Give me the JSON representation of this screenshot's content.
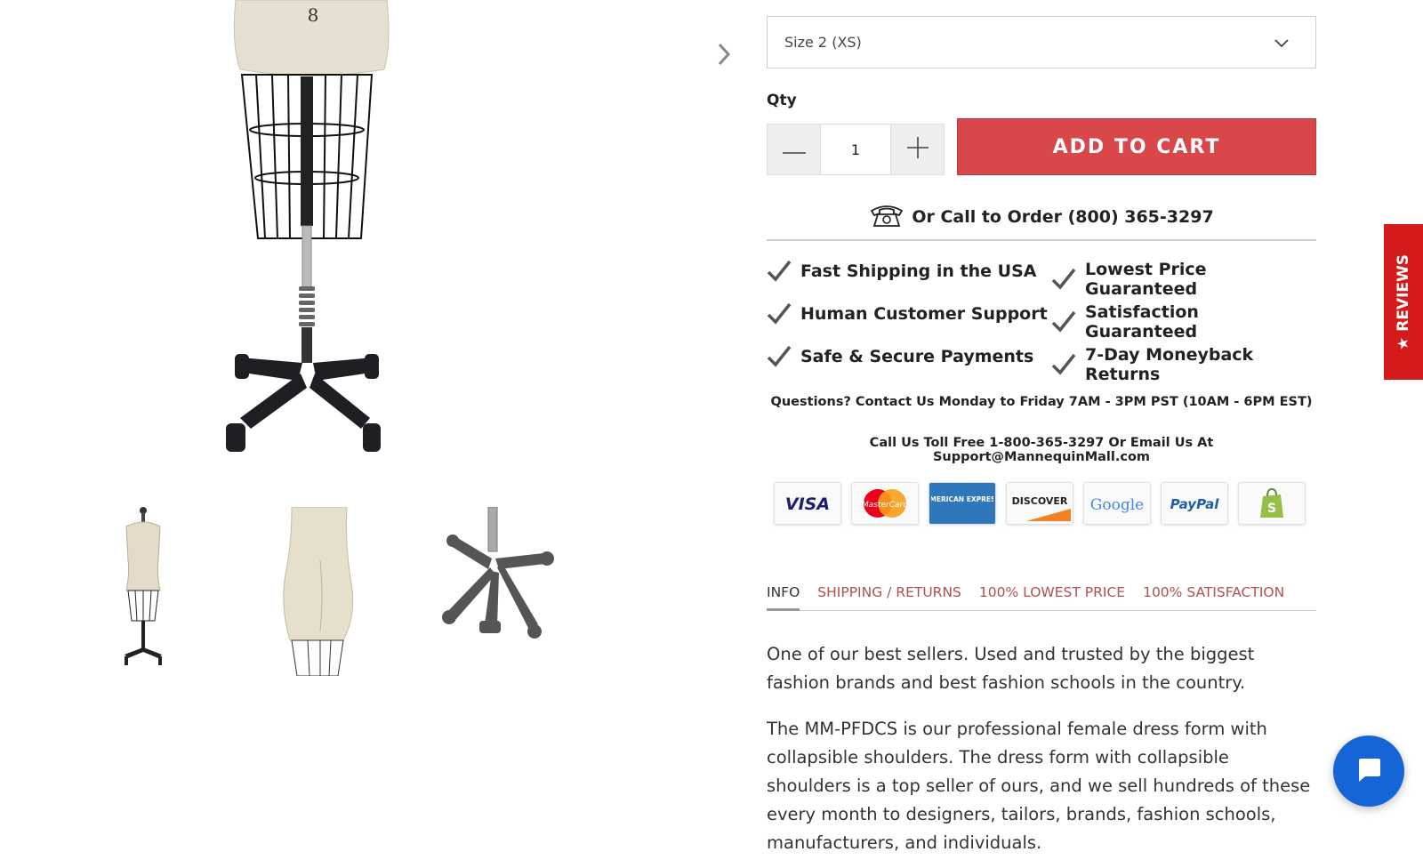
{
  "product": {
    "size_select": {
      "value": "Size 2 (XS)"
    },
    "qty_label": "Qty",
    "qty_value": "1",
    "add_to_cart_label": "ADD TO CART",
    "call_to_order": "Or Call to Order (800) 365-3297"
  },
  "features": [
    {
      "icon": "checkmark-icon",
      "label": "Fast Shipping in the USA"
    },
    {
      "icon": "checkmark-icon",
      "label": "Lowest Price Guaranteed"
    },
    {
      "icon": "checkmark-icon",
      "label": "Human Customer Support"
    },
    {
      "icon": "checkmark-icon",
      "label": "Satisfaction Guaranteed"
    },
    {
      "icon": "checkmark-icon",
      "label": "Safe & Secure Payments"
    },
    {
      "icon": "checkmark-icon",
      "label": "7-Day Moneyback Returns"
    }
  ],
  "contact": {
    "hours": "Questions? Contact Us Monday to Friday 7AM - 3PM PST (10AM - 6PM EST)",
    "toll_free": "Call Us Toll Free 1-800-365-3297 Or Email Us At Support@MannequinMall.com"
  },
  "payment_methods": [
    "VISA",
    "MasterCard",
    "AMERICAN EXPRESS",
    "DISCOVER",
    "Google",
    "PayPal",
    "Shopify"
  ],
  "tabs": [
    {
      "label": "INFO",
      "active": true
    },
    {
      "label": "SHIPPING / RETURNS",
      "active": false
    },
    {
      "label": "100% LOWEST PRICE",
      "active": false
    },
    {
      "label": "100% SATISFACTION",
      "active": false
    }
  ],
  "description": {
    "paragraph_1": "One of our best sellers. Used and trusted by the biggest fashion brands and best fashion schools in the country.",
    "paragraph_2": "The MM-PFDCS is our professional female dress form with collapsible shoulders. The dress form with collapsible shoulders is a top seller of ours, and we sell hundreds of these every month to designers, tailors, brands, fashion schools, manufacturers, and individuals."
  },
  "gallery": {
    "main_image_label": "8"
  },
  "reviews_tab": {
    "star": "★",
    "label": "REVIEWS"
  },
  "colors": {
    "add_to_cart": "#d9474a",
    "reviews_tab": "#d41a1a",
    "chat_button": "#1565d8",
    "tab_link": "#b05050"
  }
}
